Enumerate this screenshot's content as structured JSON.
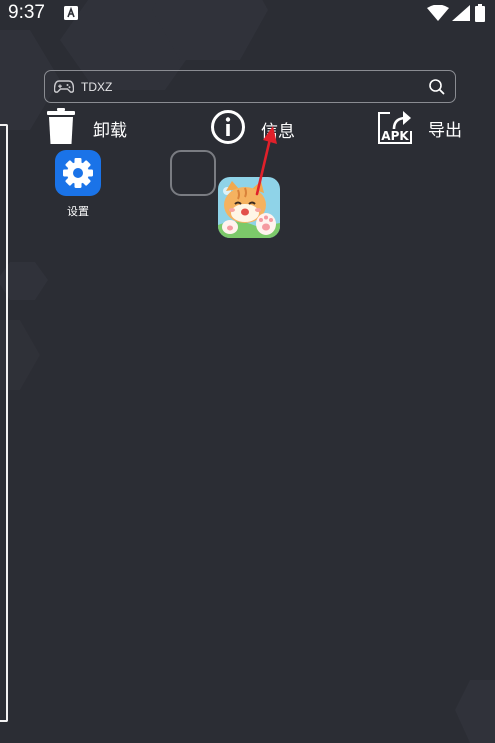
{
  "status_bar": {
    "time": "9:37"
  },
  "search": {
    "text": "TDXZ"
  },
  "actions": [
    {
      "label": "卸载",
      "icon": "trash-icon"
    },
    {
      "label": "信息",
      "icon": "info-icon"
    },
    {
      "label": "导出",
      "icon": "export-apk-icon",
      "icon_text": "APK"
    }
  ],
  "apps": [
    {
      "label": "设置",
      "icon": "settings-gear-icon",
      "color": "#1a73e8"
    }
  ],
  "dragged_app": {
    "icon": "cat-game-app-icon"
  },
  "colors": {
    "background": "#2b2d34",
    "accent_arrow": "#e0202a",
    "settings_blue": "#1a73e8"
  }
}
